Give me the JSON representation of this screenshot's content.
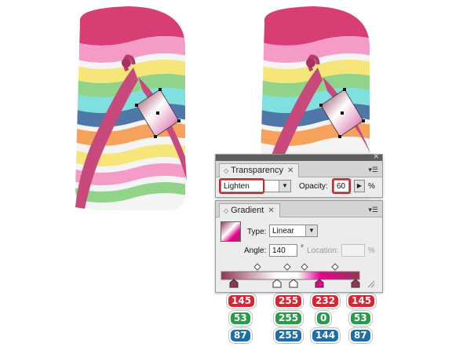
{
  "transparency": {
    "tab_label": "Transparency",
    "blend_mode": "Lighten",
    "opacity_label": "Opacity:",
    "opacity_value": "60",
    "percent": "%"
  },
  "gradient": {
    "tab_label": "Gradient",
    "type_label": "Type:",
    "type_value": "Linear",
    "angle_label": "Angle:",
    "angle_value": "140",
    "degree": "°",
    "location_label": "Location:",
    "location_value": "",
    "percent": "%"
  },
  "stops": [
    {
      "r": "145",
      "g": "53",
      "b": "87"
    },
    {
      "r": "255",
      "g": "255",
      "b": "255"
    },
    {
      "r": "232",
      "g": "0",
      "b": "144"
    },
    {
      "r": "145",
      "g": "53",
      "b": "87"
    }
  ],
  "colors": {
    "sole_top": "#d83e74",
    "strap": "#c84a7c",
    "stripe_pink": "#f49bc8",
    "stripe_yellow": "#f6e67a",
    "stripe_green": "#92d38a",
    "stripe_cyan": "#7fe0e0",
    "stripe_blue": "#4f78a8",
    "stripe_orange": "#f7a25c",
    "stripe_white": "#f4f4f4",
    "gradient_dark": "#913557",
    "gradient_magenta": "#e80090"
  }
}
